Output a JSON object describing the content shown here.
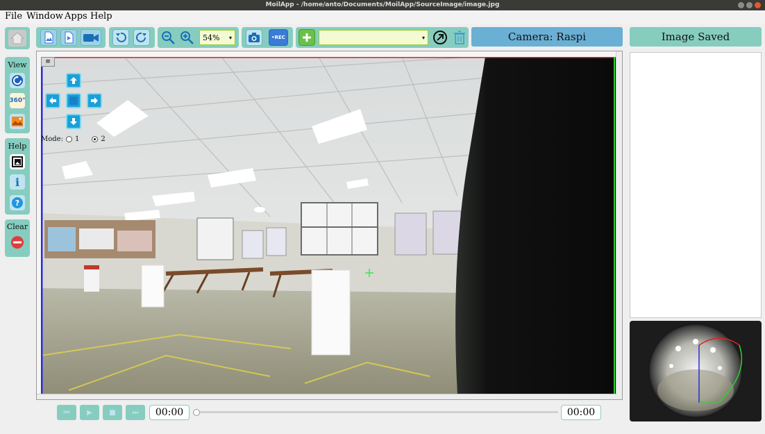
{
  "window": {
    "title": "MoilApp - /home/anto/Documents/MoilApp/SourceImage/image.jpg"
  },
  "menu": [
    "File",
    "Window",
    "Apps",
    "Help"
  ],
  "toolbar": {
    "zoom_value": "54%",
    "camera_select_value": "",
    "camera_label": "Camera: Raspi",
    "rec_label": "•REC"
  },
  "status": {
    "image_saved_label": "Image Saved"
  },
  "sidebar": {
    "view_label": "View",
    "help_label": "Help",
    "clear_label": "Clear",
    "view_360_label": "360°"
  },
  "viewer": {
    "mode_label": "Mode:",
    "mode_options": [
      "1",
      "2"
    ],
    "mode_selected": "2"
  },
  "player": {
    "time_current": "00:00",
    "time_total": "00:00",
    "progress": 0
  },
  "colors": {
    "panel": "#86cdbf",
    "header": "#6aafd4",
    "accent": "#1aa0d9"
  }
}
